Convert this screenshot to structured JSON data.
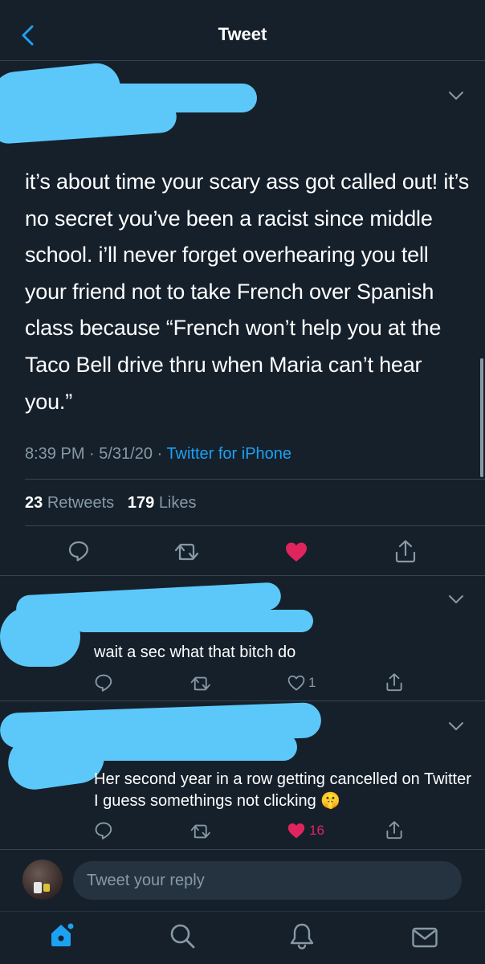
{
  "header": {
    "title": "Tweet"
  },
  "tweet": {
    "text": "it’s about time your scary ass got called out! it’s no secret you’ve been a racist since middle school. i’ll never forget overhearing you tell your friend not to take French over Spanish class because “French won’t help you at the Taco Bell drive thru when Maria can’t hear you.”",
    "time": "8:39 PM · 5/31/20 · ",
    "source": "Twitter for iPhone",
    "retweets_count": "23",
    "retweets_label": "Retweets",
    "likes_count": "179",
    "likes_label": "Likes",
    "liked": true
  },
  "replies": [
    {
      "text": "wait a sec what that bitch do",
      "like_count": "1",
      "liked": false
    },
    {
      "text": "Her second year in a row getting cancelled on Twitter I guess somethings not clicking",
      "emoji": "🤫",
      "like_count": "16",
      "liked": true
    }
  ],
  "composer": {
    "placeholder": "Tweet your reply"
  },
  "tabbar": {
    "items": [
      "home-icon",
      "search-icon",
      "notifications-icon",
      "messages-icon"
    ]
  },
  "colors": {
    "background": "#15202b",
    "accent": "#1da1f2",
    "like": "#e0245e",
    "redaction": "#5cc8fa"
  }
}
